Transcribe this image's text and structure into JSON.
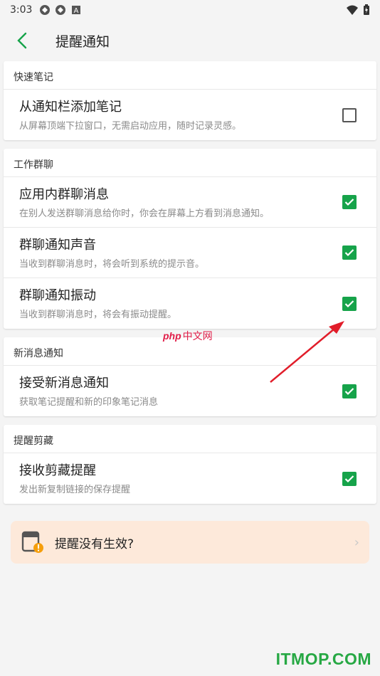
{
  "status_bar": {
    "time": "3:03"
  },
  "header": {
    "title": "提醒通知"
  },
  "sections": [
    {
      "title": "快速笔记",
      "items": [
        {
          "title": "从通知栏添加笔记",
          "subtitle": "从屏幕顶端下拉窗口，无需启动应用，随时记录灵感。",
          "checked": false
        }
      ]
    },
    {
      "title": "工作群聊",
      "items": [
        {
          "title": "应用内群聊消息",
          "subtitle": "在别人发送群聊消息给你时，你会在屏幕上方看到消息通知。",
          "checked": true
        },
        {
          "title": "群聊通知声音",
          "subtitle": "当收到群聊消息时，将会听到系统的提示音。",
          "checked": true
        },
        {
          "title": "群聊通知振动",
          "subtitle": "当收到群聊消息时，将会有振动提醒。",
          "checked": true
        }
      ]
    },
    {
      "title": "新消息通知",
      "items": [
        {
          "title": "接受新消息通知",
          "subtitle": "获取笔记提醒和新的印象笔记消息",
          "checked": true
        }
      ]
    },
    {
      "title": "提醒剪藏",
      "items": [
        {
          "title": "接收剪藏提醒",
          "subtitle": "发出新复制链接的保存提醒",
          "checked": true
        }
      ]
    }
  ],
  "hint": {
    "label": "提醒没有生效?"
  },
  "watermarks": {
    "php": "php",
    "cn": "中文网",
    "itmop": "ITMOP.COM"
  },
  "colors": {
    "accent": "#16a34a",
    "hint_bg": "#fde9da",
    "arrow": "#e11d2a"
  }
}
